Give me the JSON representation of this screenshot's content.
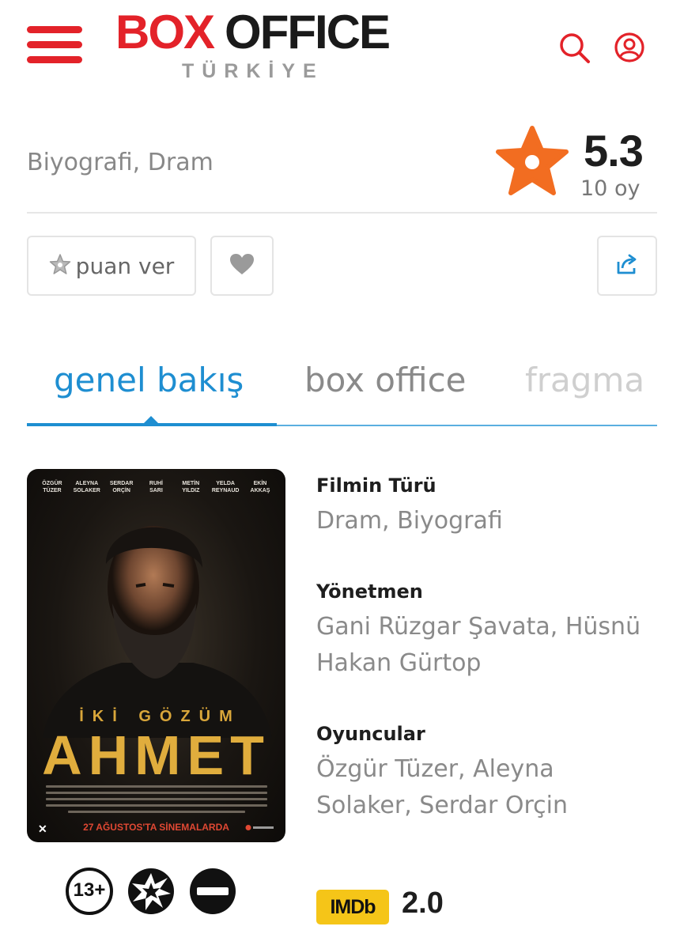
{
  "header": {
    "logo_box": "BOX",
    "logo_office": "OFFICE",
    "logo_sub": "TÜRKİYE",
    "menu_icon": "hamburger-menu-icon",
    "search_icon": "search-icon",
    "user_icon": "user-icon"
  },
  "movie": {
    "genres": "Biyografi, Dram",
    "rating": "5.3",
    "votes": "10 oy"
  },
  "actions": {
    "rate_label": "puan ver",
    "favorite_icon": "heart-icon",
    "share_icon": "share-icon"
  },
  "tabs": [
    {
      "label": "genel bakış",
      "active": true
    },
    {
      "label": "box office",
      "active": false
    },
    {
      "label": "fragma",
      "active": false
    }
  ],
  "poster": {
    "cast": [
      {
        "first": "ÖZGÜR",
        "last": "TÜZER"
      },
      {
        "first": "ALEYNA",
        "last": "SOLAKER"
      },
      {
        "first": "SERDAR",
        "last": "ORÇİN"
      },
      {
        "first": "RUHİ",
        "last": "SARI"
      },
      {
        "first": "METİN",
        "last": "YILDIZ"
      },
      {
        "first": "YELDA",
        "last": "REYNAUD"
      },
      {
        "first": "EKİN",
        "last": "AKKAŞ"
      }
    ],
    "pretitle": "İKİ GÖZÜM",
    "title": "AHMET",
    "release": "27 AĞUSTOS'TA SİNEMALARDA"
  },
  "badges": {
    "age": "13+",
    "violence_icon": "violence-icon",
    "negative_icon": "negative-example-icon"
  },
  "details": {
    "genre_label": "Filmin Türü",
    "genre_value": "Dram, Biyografi",
    "director_label": "Yönetmen",
    "director_value": "Gani Rüzgar Şavata, Hüsnü Hakan Gürtop",
    "cast_label": "Oyuncular",
    "cast_value": "Özgür Tüzer, Aleyna Solaker, Serdar Orçin"
  },
  "imdb": {
    "logo": "IMDb",
    "score": "2.0"
  },
  "colors": {
    "brand_red": "#e32229",
    "accent_blue": "#1e8ed1",
    "star_orange": "#f26d21",
    "imdb_yellow": "#f5c518"
  }
}
